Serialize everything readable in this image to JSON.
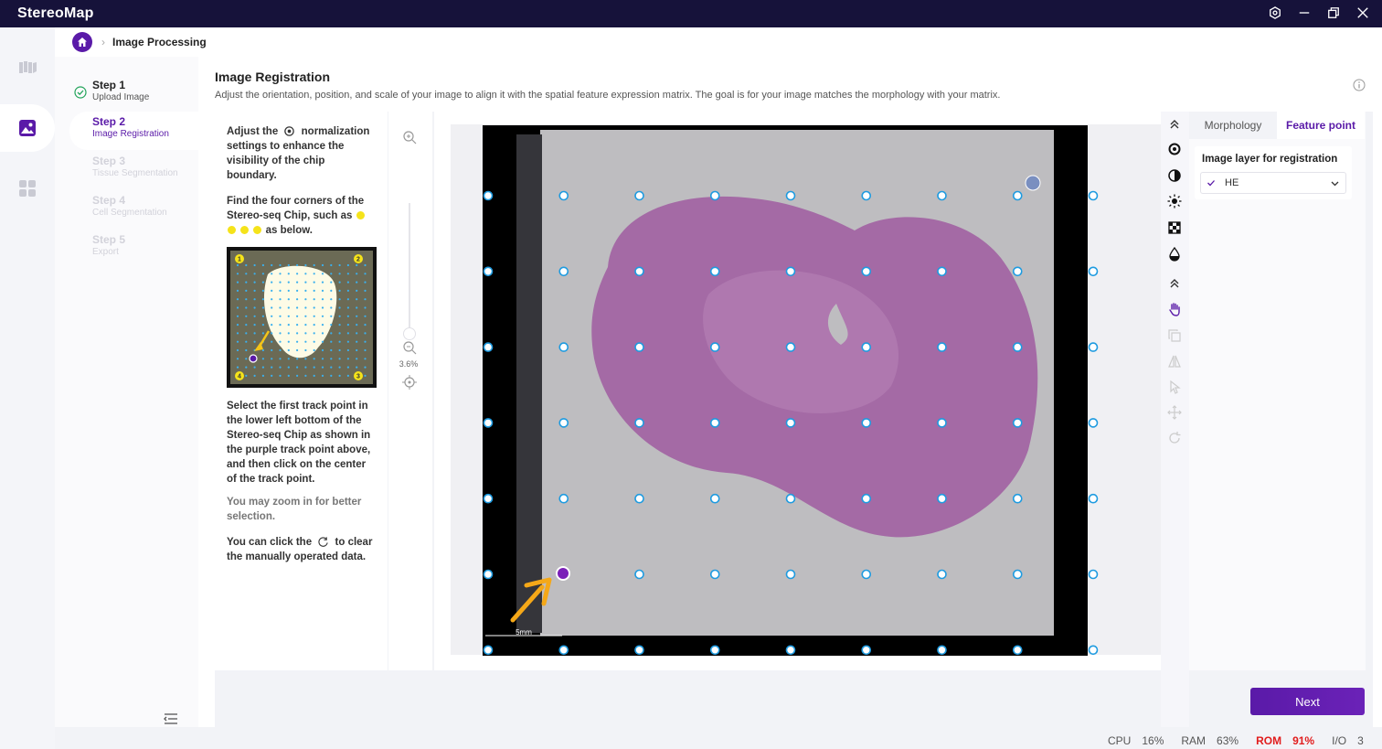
{
  "app": {
    "title": "StereoMap"
  },
  "breadcrumb": {
    "current": "Image Processing"
  },
  "steps": [
    {
      "title": "Step 1",
      "subtitle": "Upload Image",
      "state": "done"
    },
    {
      "title": "Step 2",
      "subtitle": "Image Registration",
      "state": "active"
    },
    {
      "title": "Step 3",
      "subtitle": "Tissue Segmentation",
      "state": "disabled"
    },
    {
      "title": "Step 4",
      "subtitle": "Cell Segmentation",
      "state": "disabled"
    },
    {
      "title": "Step 5",
      "subtitle": "Export",
      "state": "disabled"
    }
  ],
  "page": {
    "title": "Image Registration",
    "description": "Adjust the orientation, position, and scale of your image to align it with the spatial feature expression matrix. The goal is for your image matches the morphology with your matrix."
  },
  "instructions": {
    "p1_a": "Adjust the",
    "p1_b": "normalization settings to enhance the visibility of the chip boundary.",
    "p2_a": "Find the four corners of the Stereo-seq Chip, such as",
    "p2_b": "as below.",
    "p3": "Select the first track point in the lower left bottom of the Stereo-seq Chip as shown in the purple track point above, and then click on the center of the track point.",
    "p4": "You may zoom in for better selection.",
    "p5_a": "You can click the",
    "p5_b": "to clear the manually operated data."
  },
  "thumbnail": {
    "badges": [
      "1",
      "2",
      "3",
      "4"
    ]
  },
  "zoom": {
    "level": "3.6%"
  },
  "canvas": {
    "scale_label": "5mm"
  },
  "right_panel": {
    "tabs": [
      {
        "label": "Morphology",
        "active": false
      },
      {
        "label": "Feature point",
        "active": true
      }
    ],
    "layer_label": "Image layer for registration",
    "layer_value": "HE"
  },
  "actions": {
    "next": "Next"
  },
  "status": {
    "cpu_label": "CPU",
    "cpu_value": "16%",
    "ram_label": "RAM",
    "ram_value": "63%",
    "rom_label": "ROM",
    "rom_value": "91%",
    "io_label": "I/O",
    "io_value": "3"
  },
  "colors": {
    "brand": "#5a1aa8",
    "titlebar": "#16123a",
    "track_point": "#1e9be0",
    "warning": "#e11d1d"
  }
}
